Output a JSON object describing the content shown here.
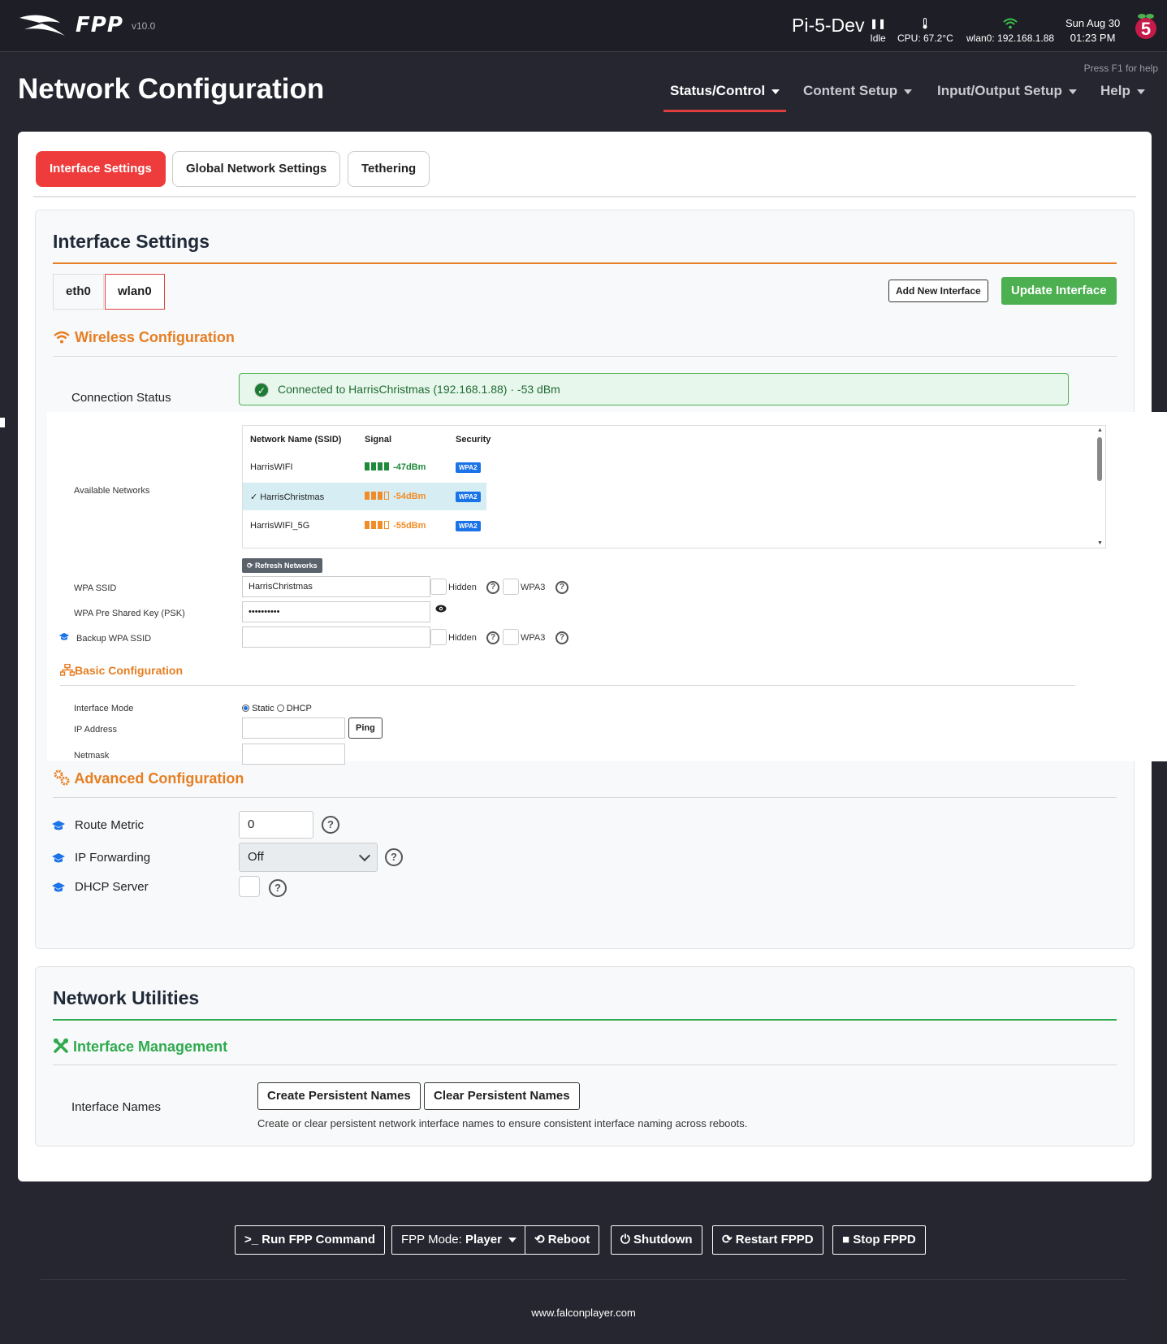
{
  "header": {
    "brand": "FPP",
    "version": "v10.0",
    "hostname": "Pi-5-Dev",
    "status": "Idle",
    "cpu": "CPU: 67.2°C",
    "wifi": "wlan0: 192.168.1.88",
    "date": "Sun Aug 30",
    "time": "01:23 PM",
    "help_hint": "Press F1 for help"
  },
  "page": {
    "title": "Network Configuration"
  },
  "nav": [
    {
      "label": "Status/Control",
      "active": true
    },
    {
      "label": "Content Setup"
    },
    {
      "label": "Input/Output Setup"
    },
    {
      "label": "Help"
    }
  ],
  "tabs": [
    {
      "label": "Interface Settings",
      "active": true
    },
    {
      "label": "Global Network Settings"
    },
    {
      "label": "Tethering"
    }
  ],
  "interface_settings": {
    "title": "Interface Settings",
    "interfaces": [
      "eth0",
      "wlan0"
    ],
    "selected_interface": "wlan0",
    "add_button": "Add New Interface",
    "update_button": "Update Interface",
    "wireless": {
      "heading": "Wireless Configuration",
      "connection_status_label": "Connection Status",
      "connection_status": "Connected to HarrisChristmas (192.168.1.88) · -53 dBm",
      "available_networks_label": "Available Networks",
      "columns": [
        "Network Name (SSID)",
        "Signal",
        "Security"
      ],
      "networks": [
        {
          "ssid": "HarrisWIFI",
          "signal": "-47dBm",
          "bars": 4,
          "security": "WPA2",
          "selected": false
        },
        {
          "ssid": "HarrisChristmas",
          "signal": "-54dBm",
          "bars": 3,
          "security": "WPA2",
          "selected": true
        },
        {
          "ssid": "HarrisWIFI_5G",
          "signal": "-55dBm",
          "bars": 3,
          "security": "WPA2",
          "selected": false
        }
      ],
      "refresh_button": "Refresh Networks",
      "wpa_ssid_label": "WPA SSID",
      "wpa_ssid_value": "HarrisChristmas",
      "psk_label": "WPA Pre Shared Key (PSK)",
      "psk_value": "••••••••••",
      "backup_ssid_label": "Backup WPA SSID",
      "backup_ssid_value": "",
      "hidden_label": "Hidden",
      "wpa3_label": "WPA3"
    },
    "basic": {
      "heading": "Basic Configuration",
      "mode_label": "Interface Mode",
      "mode_static": "Static",
      "mode_dhcp": "DHCP",
      "mode_selected": "Static",
      "ip_label": "IP Address",
      "ip_value": "",
      "ping_button": "Ping",
      "netmask_label": "Netmask",
      "netmask_value": ""
    },
    "advanced": {
      "heading": "Advanced Configuration",
      "route_metric_label": "Route Metric",
      "route_metric_value": "0",
      "ip_forwarding_label": "IP Forwarding",
      "ip_forwarding_value": "Off",
      "dhcp_server_label": "DHCP Server"
    }
  },
  "utilities": {
    "title": "Network Utilities",
    "heading": "Interface Management",
    "names_label": "Interface Names",
    "create_button": "Create Persistent Names",
    "clear_button": "Clear Persistent Names",
    "help": "Create or clear persistent network interface names to ensure consistent interface naming across reboots."
  },
  "footer": {
    "run_command": "Run FPP Command",
    "mode_prefix": "FPP Mode:",
    "mode_value": "Player",
    "reboot": "Reboot",
    "shutdown": "Shutdown",
    "restart": "Restart FPPD",
    "stop": "Stop FPPD",
    "link": "www.falconplayer.com"
  },
  "colors": {
    "accent_red": "#ee3b3b",
    "orange": "#e67e22",
    "green": "#4caf50",
    "background": "#252630"
  }
}
